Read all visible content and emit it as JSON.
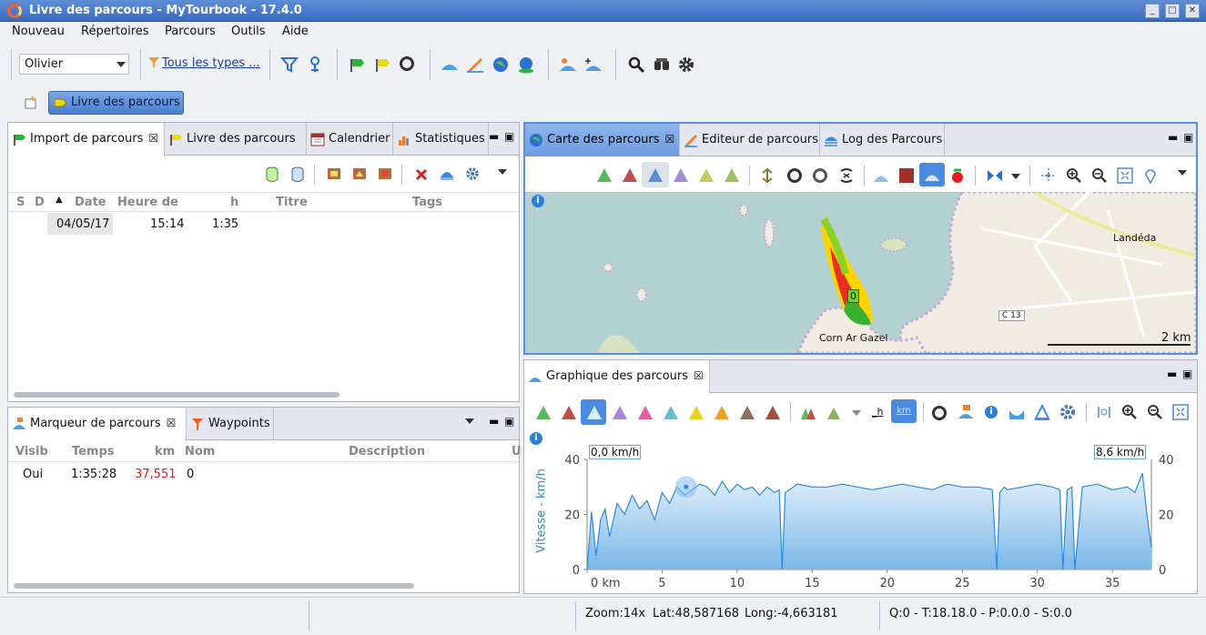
{
  "window": {
    "title": "Livre des parcours - MyTourbook - 17.4.0"
  },
  "menu": [
    "Nouveau",
    "Répertoires",
    "Parcours",
    "Outils",
    "Aide"
  ],
  "toolbar": {
    "user": "Olivier",
    "filter_link": "Tous les types ..."
  },
  "perspective": {
    "label": "Livre des parcours"
  },
  "left_top": {
    "tabs": [
      "Import de parcours",
      "Livre des parcours",
      "Calendrier",
      "Statistiques"
    ],
    "columns": [
      "S",
      "D",
      "Date",
      "Heure de",
      "h",
      "Titre",
      "Tags"
    ],
    "rows": [
      {
        "date": "04/05/17",
        "time": "15:14",
        "duration": "1:35"
      }
    ]
  },
  "left_bottom": {
    "tabs": [
      "Marqueur de parcours",
      "Waypoints"
    ],
    "columns": [
      "Visib",
      "Temps",
      "km",
      "Nom",
      "Description",
      "U"
    ],
    "rows": [
      {
        "visible": "Oui",
        "time": "1:35:28",
        "km": "37,551",
        "name": "0"
      }
    ]
  },
  "right_top": {
    "tabs": [
      "Carte des parcours",
      "Editeur de parcours",
      "Log des Parcours"
    ],
    "map": {
      "place1": "Landéda",
      "place2": "Corn Ar Gazel",
      "road": "C 13",
      "scale": "2 km",
      "marker": "0"
    }
  },
  "right_bottom": {
    "tabs": [
      "Graphique des parcours"
    ],
    "chart_data": {
      "type": "area",
      "ylabel": "Vitesse - km/h",
      "xlabel": "km",
      "ylim": [
        0,
        40
      ],
      "yticks": [
        0,
        20,
        40
      ],
      "xticks": [
        0,
        5,
        10,
        15,
        20,
        25,
        30,
        35
      ],
      "xlim": [
        0,
        37.6
      ],
      "left_value_label": "0,0 km/h",
      "right_value_label": "8,6 km/h",
      "series": [
        {
          "x": [
            0,
            0.3,
            0.6,
            0.9,
            1.2,
            1.5,
            2,
            2.5,
            3,
            3.5,
            4,
            4.5,
            5,
            5.5,
            6,
            6.5,
            7,
            7.5,
            8,
            8.5,
            9,
            9.5,
            10,
            10.5,
            11,
            11.5,
            12,
            12.5,
            12.8,
            13,
            13.2,
            13.5,
            14,
            15,
            16,
            17,
            18,
            19,
            20,
            21,
            22,
            23,
            24,
            25,
            26,
            27,
            27.3,
            27.5,
            27.8,
            28,
            29,
            30,
            31,
            31.5,
            31.7,
            32,
            32.3,
            32.5,
            33,
            34,
            35,
            36,
            36.5,
            37,
            37.3,
            37.6
          ],
          "y": [
            0,
            21,
            5,
            18,
            22,
            12,
            24,
            20,
            27,
            22,
            25,
            18,
            28,
            24,
            30,
            27,
            29,
            31,
            30,
            27,
            32,
            28,
            31,
            29,
            30,
            27,
            30,
            28,
            29,
            0,
            28,
            29,
            31,
            30,
            30,
            31,
            30,
            29,
            30,
            31,
            30,
            29,
            31,
            30,
            30,
            29,
            0,
            28,
            30,
            29,
            30,
            31,
            30,
            29,
            0,
            29,
            30,
            0,
            30,
            31,
            29,
            30,
            28,
            35,
            20,
            8
          ]
        }
      ],
      "color": "#2e8ad8"
    }
  },
  "status": {
    "zoom": "Zoom:14x",
    "lat": "Lat:48,587168",
    "long": "Long:-4,663181",
    "q": "Q:0 - T:18.18.0 - P:0.0.0 - S:0.0"
  }
}
